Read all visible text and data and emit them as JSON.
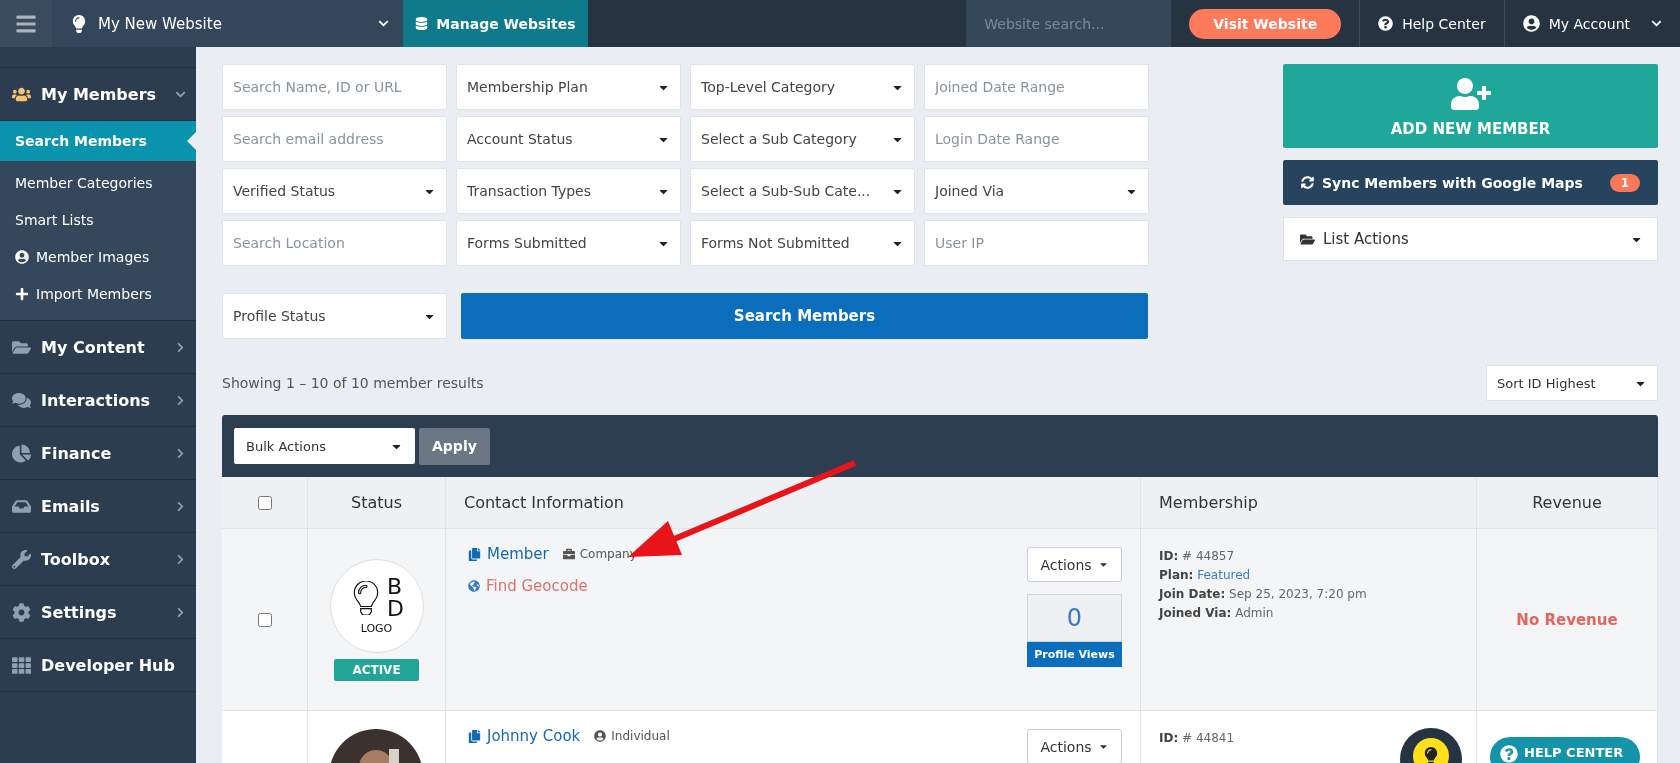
{
  "topbar": {
    "website": "My New Website",
    "manage": "Manage Websites",
    "search_placeholder": "Website search...",
    "visit": "Visit Website",
    "help": "Help Center",
    "account": "My Account"
  },
  "sidebar": {
    "items": [
      {
        "label": "My Members",
        "expanded": true,
        "children": [
          {
            "label": "Search Members",
            "selected": true
          },
          {
            "label": "Member Categories",
            "selected": false
          },
          {
            "label": "Smart Lists",
            "selected": false
          },
          {
            "label": "Member Images",
            "selected": false
          },
          {
            "label": "Import Members",
            "selected": false
          }
        ]
      },
      {
        "label": "My Content",
        "expanded": false
      },
      {
        "label": "Interactions",
        "expanded": false
      },
      {
        "label": "Finance",
        "expanded": false
      },
      {
        "label": "Emails",
        "expanded": false
      },
      {
        "label": "Toolbox",
        "expanded": false
      },
      {
        "label": "Settings",
        "expanded": false
      },
      {
        "label": "Developer Hub"
      }
    ]
  },
  "filters": [
    {
      "kind": "input",
      "placeholder": "Search Name, ID or URL"
    },
    {
      "kind": "select",
      "label": "Membership Plan"
    },
    {
      "kind": "select",
      "label": "Top-Level Category"
    },
    {
      "kind": "input",
      "placeholder": "Joined Date Range"
    },
    {
      "kind": "input",
      "placeholder": "Search email address"
    },
    {
      "kind": "select",
      "label": "Account Status"
    },
    {
      "kind": "select",
      "label": "Select a Sub Category"
    },
    {
      "kind": "input",
      "placeholder": "Login Date Range"
    },
    {
      "kind": "select",
      "label": "Verified Status"
    },
    {
      "kind": "select",
      "label": "Transaction Types"
    },
    {
      "kind": "select",
      "label": "Select a Sub-Sub Cate..."
    },
    {
      "kind": "select",
      "label": "Joined Via"
    },
    {
      "kind": "input",
      "placeholder": "Search Location"
    },
    {
      "kind": "select",
      "label": "Forms Submitted"
    },
    {
      "kind": "select",
      "label": "Forms Not Submitted"
    },
    {
      "kind": "input",
      "placeholder": "User IP"
    }
  ],
  "profile_status": "Profile Status",
  "search_button": "Search Members",
  "actions_panel": {
    "add": "ADD NEW MEMBER",
    "sync": "Sync Members with Google Maps",
    "sync_count": "1",
    "list_actions": "List Actions"
  },
  "results_summary": "Showing 1 – 10 of 10 member results",
  "sort": "Sort ID Highest",
  "table": {
    "bulk": "Bulk Actions",
    "apply": "Apply",
    "select_all_checked": false,
    "columns": [
      "Status",
      "Contact Information",
      "Membership",
      "Revenue"
    ],
    "rows": [
      {
        "checked": false,
        "avatar": {
          "kind": "logo",
          "letters": [
            "B",
            "D"
          ],
          "caption": "LOGO"
        },
        "status": "ACTIVE",
        "name": "Member",
        "type": "Company",
        "geocode": "Find Geocode",
        "actions": "Actions",
        "views": "0",
        "views_label": "Profile Views",
        "membership": [
          {
            "label": "ID:",
            "value": "# 44857",
            "link": false
          },
          {
            "label": "Plan:",
            "value": "Featured",
            "link": true
          },
          {
            "label": "Join Date:",
            "value": "Sep 25, 2023, 7:20 pm",
            "link": false
          },
          {
            "label": "Joined Via:",
            "value": "Admin",
            "link": false
          }
        ],
        "revenue": "No Revenue"
      },
      {
        "avatar": {
          "kind": "picture"
        },
        "name": "Johnny Cook",
        "type": "Individual",
        "actions": "Actions",
        "membership": [
          {
            "label": "ID:",
            "value": "# 44841",
            "link": false
          }
        ]
      }
    ]
  },
  "help_widget": "HELP CENTER"
}
